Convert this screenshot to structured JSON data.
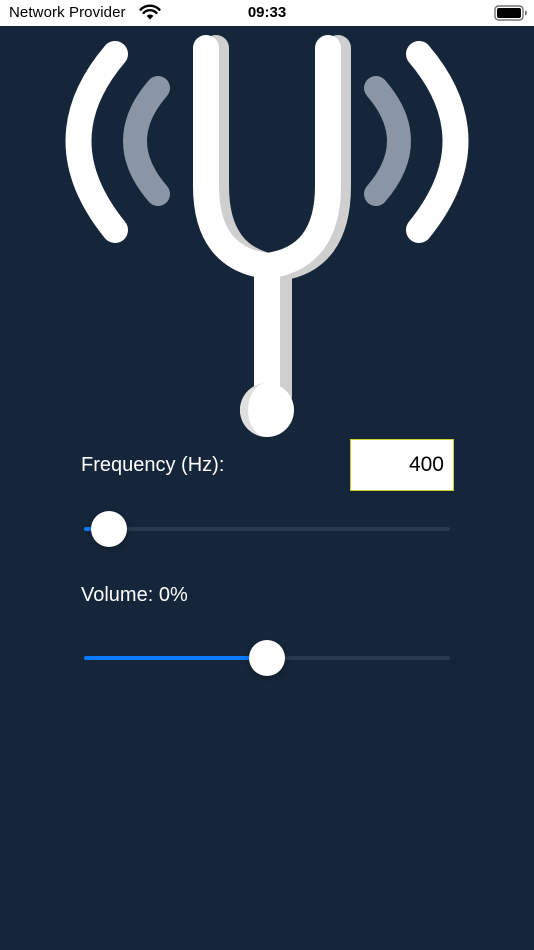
{
  "status_bar": {
    "carrier": "Network Provider",
    "time": "09:33",
    "icons": [
      "wifi-icon",
      "battery-icon"
    ]
  },
  "logo": {
    "icon": "tuning-fork-icon"
  },
  "frequency": {
    "label": "Frequency (Hz):",
    "value": "400",
    "slider_fraction": 0.06
  },
  "volume": {
    "label": "Volume: 0%",
    "slider_fraction": 0.5
  },
  "colors": {
    "background": "#16263A",
    "accent": "#0A7AFF",
    "track": "#2A3A4E",
    "input_border": "#C9D12B"
  }
}
